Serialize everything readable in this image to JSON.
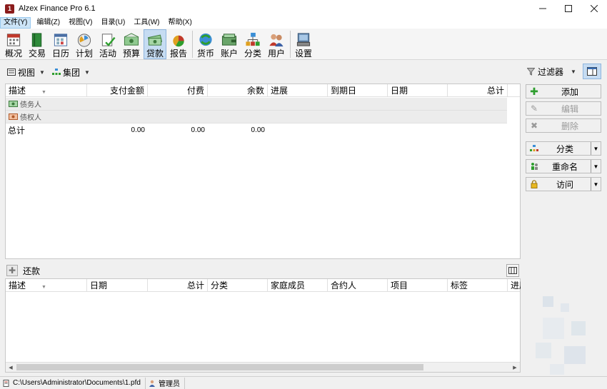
{
  "window": {
    "title": "Alzex Finance Pro 6.1",
    "app_icon_text": "1"
  },
  "menu": [
    "文件(Y)",
    "编辑(Z)",
    "视图(V)",
    "目录(U)",
    "工具(W)",
    "帮助(X)"
  ],
  "toolbar": [
    {
      "label": "概况",
      "icon": "overview-calendar-icon"
    },
    {
      "label": "交易",
      "icon": "transactions-book-icon"
    },
    {
      "label": "日历",
      "icon": "calendar-icon"
    },
    {
      "label": "计划",
      "icon": "plan-clipboard-icon"
    },
    {
      "label": "活动",
      "icon": "activity-check-icon"
    },
    {
      "label": "预算",
      "icon": "budget-money-icon"
    },
    {
      "label": "贷款",
      "icon": "loan-cash-icon",
      "selected": true
    },
    {
      "label": "报告",
      "icon": "report-chart-icon"
    },
    {
      "label": "货币",
      "icon": "currency-exchange-icon"
    },
    {
      "label": "账户",
      "icon": "accounts-wallet-icon"
    },
    {
      "label": "分类",
      "icon": "categories-tree-icon"
    },
    {
      "label": "用户",
      "icon": "users-icon"
    },
    {
      "label": "设置",
      "icon": "settings-computer-icon"
    }
  ],
  "subbar": {
    "view_label": "视图",
    "group_label": "集团"
  },
  "loans_grid": {
    "columns": [
      "描述",
      "支付金额",
      "付费",
      "余数",
      "进展",
      "到期日",
      "日期",
      "总计"
    ],
    "groups": [
      "债务人",
      "债权人"
    ],
    "total_row": {
      "label": "总计",
      "payment": "0.00",
      "paid": "0.00",
      "remainder": "0.00"
    }
  },
  "right_panel": {
    "filter_label": "过滤器",
    "buttons": {
      "add": "添加",
      "edit": "编辑",
      "delete": "删除",
      "category": "分类",
      "rename": "重命名",
      "access": "访问"
    }
  },
  "repayments": {
    "title": "还款",
    "columns": [
      "描述",
      "日期",
      "总计",
      "分类",
      "家庭成员",
      "合约人",
      "项目",
      "标签",
      "进展"
    ]
  },
  "status": {
    "file_path": "C:\\Users\\Administrator\\Documents\\1.pfd",
    "user": "管理员"
  },
  "colors": {
    "selected_bg": "#c6dcf2",
    "group_bg": "#ececec",
    "add_green": "#2e9e2e"
  }
}
